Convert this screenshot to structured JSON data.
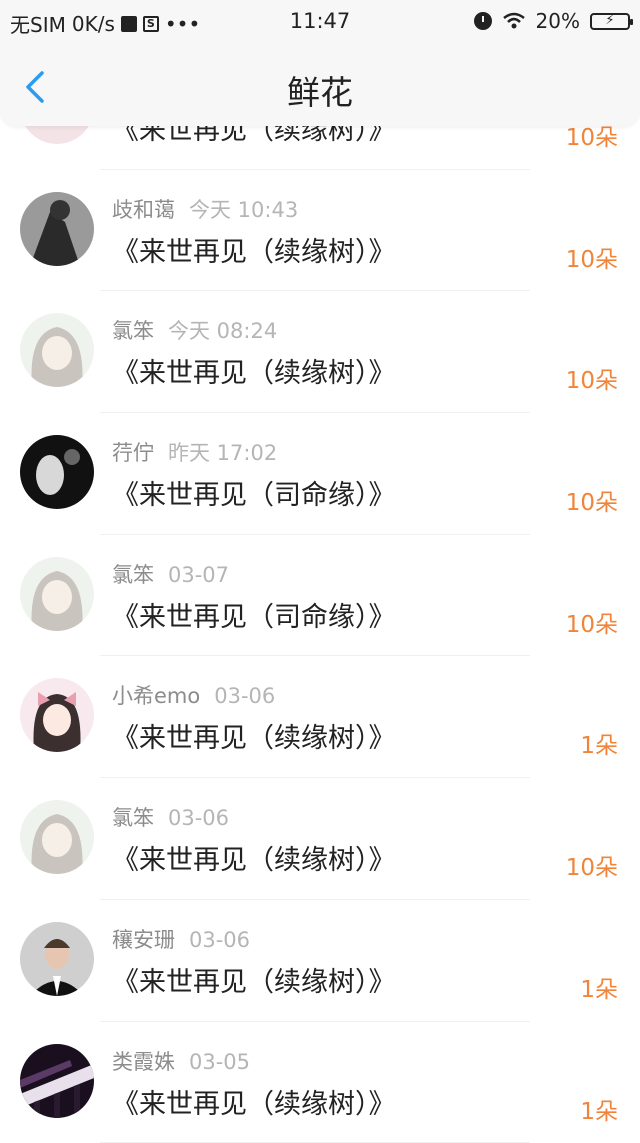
{
  "status_bar": {
    "carrier": "无SIM",
    "speed": "0K/s",
    "dots": "•••",
    "time": "11:47",
    "battery": "20%"
  },
  "nav": {
    "title": "鲜花"
  },
  "colors": {
    "accent_blue": "#2a9cf0",
    "count_orange": "#f0843a"
  },
  "rows": [
    {
      "name": "",
      "time": "",
      "song": "《来世再见（续缘树）》",
      "count": "10朵",
      "avatar": "pink-avatar"
    },
    {
      "name": "歧和蔼",
      "time": "今天 10:43",
      "song": "《来世再见（续缘树）》",
      "count": "10朵",
      "avatar": "dark-photo-avatar"
    },
    {
      "name": "氯笨",
      "time": "今天 08:24",
      "song": "《来世再见（续缘树）》",
      "count": "10朵",
      "avatar": "anime-girl-avatar"
    },
    {
      "name": "荇佇",
      "time": "昨天 17:02",
      "song": "《来世再见（司命缘）》",
      "count": "10朵",
      "avatar": "black-white-avatar"
    },
    {
      "name": "氯笨",
      "time": "03-07",
      "song": "《来世再见（司命缘）》",
      "count": "10朵",
      "avatar": "anime-girl-avatar"
    },
    {
      "name": "小希emo",
      "time": "03-06",
      "song": "《来世再见（续缘树）》",
      "count": "1朵",
      "avatar": "anime-bow-avatar"
    },
    {
      "name": "氯笨",
      "time": "03-06",
      "song": "《来世再见（续缘树）》",
      "count": "10朵",
      "avatar": "anime-girl-avatar"
    },
    {
      "name": "穰安珊",
      "time": "03-06",
      "song": "《来世再见（续缘树）》",
      "count": "1朵",
      "avatar": "man-suit-avatar"
    },
    {
      "name": "类霞姝",
      "time": "03-05",
      "song": "《来世再见（续缘树）》",
      "count": "1朵",
      "avatar": "piano-avatar"
    }
  ]
}
